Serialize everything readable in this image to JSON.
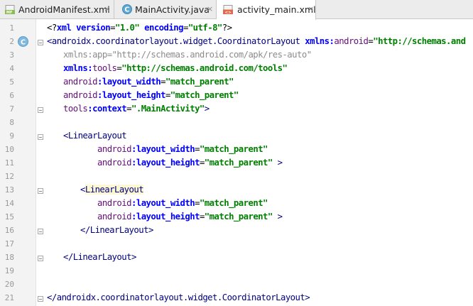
{
  "tabs": [
    {
      "label": "AndroidManifest.xml",
      "icon": "manifest-file-icon",
      "badge": "MF",
      "active": false
    },
    {
      "label": "MainActivity.java",
      "icon": "java-class-icon",
      "badge": "C",
      "active": false
    },
    {
      "label": "activity_main.xml",
      "icon": "xml-layout-file-icon",
      "badge": "<>",
      "active": true
    }
  ],
  "close_glyph": "×",
  "gutter_badge": "C",
  "lines": [
    {
      "n": "1"
    },
    {
      "n": "2"
    },
    {
      "n": "3"
    },
    {
      "n": "4"
    },
    {
      "n": "5"
    },
    {
      "n": "6"
    },
    {
      "n": "7"
    },
    {
      "n": "8"
    },
    {
      "n": "9"
    },
    {
      "n": "10"
    },
    {
      "n": "11"
    },
    {
      "n": "12"
    },
    {
      "n": "13"
    },
    {
      "n": "14"
    },
    {
      "n": "15"
    },
    {
      "n": "16"
    },
    {
      "n": "17"
    },
    {
      "n": "18"
    },
    {
      "n": "19"
    },
    {
      "n": "20"
    },
    {
      "n": "21"
    }
  ],
  "code": {
    "l1": {
      "open": "<?",
      "tag": "xml",
      "attr1": "version",
      "eq1": "=",
      "val1": "\"1.0\"",
      "attr2": "encoding",
      "eq2": "=",
      "val2": "\"utf-8\"",
      "close": "?>"
    },
    "l2": {
      "open": "<",
      "tag": "androidx.coordinatorlayout.widget.CoordinatorLayout",
      "ns": "xmlns",
      "colon": ":",
      "attr": "android",
      "eq": "=",
      "val": "\"http://schemas.and"
    },
    "l3": {
      "ns": "xmlns",
      "colon": ":",
      "attr": "app",
      "eq": "=",
      "val": "\"http://schemas.android.com/apk/res-auto\""
    },
    "l4": {
      "ns": "xmlns",
      "colon": ":",
      "attr": "tools",
      "eq": "=",
      "val": "\"http://schemas.android.com/tools\""
    },
    "l5": {
      "ns": "android",
      "colon": ":",
      "attr": "layout_width",
      "eq": "=",
      "val": "\"match_parent\""
    },
    "l6": {
      "ns": "android",
      "colon": ":",
      "attr": "layout_height",
      "eq": "=",
      "val": "\"match_parent\""
    },
    "l7": {
      "ns": "tools",
      "colon": ":",
      "attr": "context",
      "eq": "=",
      "val": "\".MainActivity\"",
      "close": ">"
    },
    "l9": {
      "open": "<",
      "tag": "LinearLayout"
    },
    "l10": {
      "ns": "android",
      "colon": ":",
      "attr": "layout_width",
      "eq": "=",
      "val": "\"match_parent\""
    },
    "l11": {
      "ns": "android",
      "colon": ":",
      "attr": "layout_height",
      "eq": "=",
      "val": "\"match_parent\"",
      "close": " >"
    },
    "l13": {
      "open": "<",
      "tag": "LinearLayout"
    },
    "l14": {
      "ns": "android",
      "colon": ":",
      "attr": "layout_width",
      "eq": "=",
      "val": "\"match_parent\""
    },
    "l15": {
      "ns": "android",
      "colon": ":",
      "attr": "layout_height",
      "eq": "=",
      "val": "\"match_parent\"",
      "close": " >"
    },
    "l16": {
      "open": "</",
      "tag": "LinearLayout",
      "close": ">"
    },
    "l18": {
      "open": "</",
      "tag": "LinearLayout",
      "close": ">"
    },
    "l21": {
      "open": "</",
      "tag": "androidx.coordinatorlayout.widget.CoordinatorLayout",
      "close": ">"
    }
  },
  "colors": {
    "tag": "#000080",
    "attribute": "#0000ff",
    "namespace": "#660e7a",
    "string": "#008000",
    "highlight": "#fdf8d4",
    "gutter": "#f3f3f3"
  }
}
